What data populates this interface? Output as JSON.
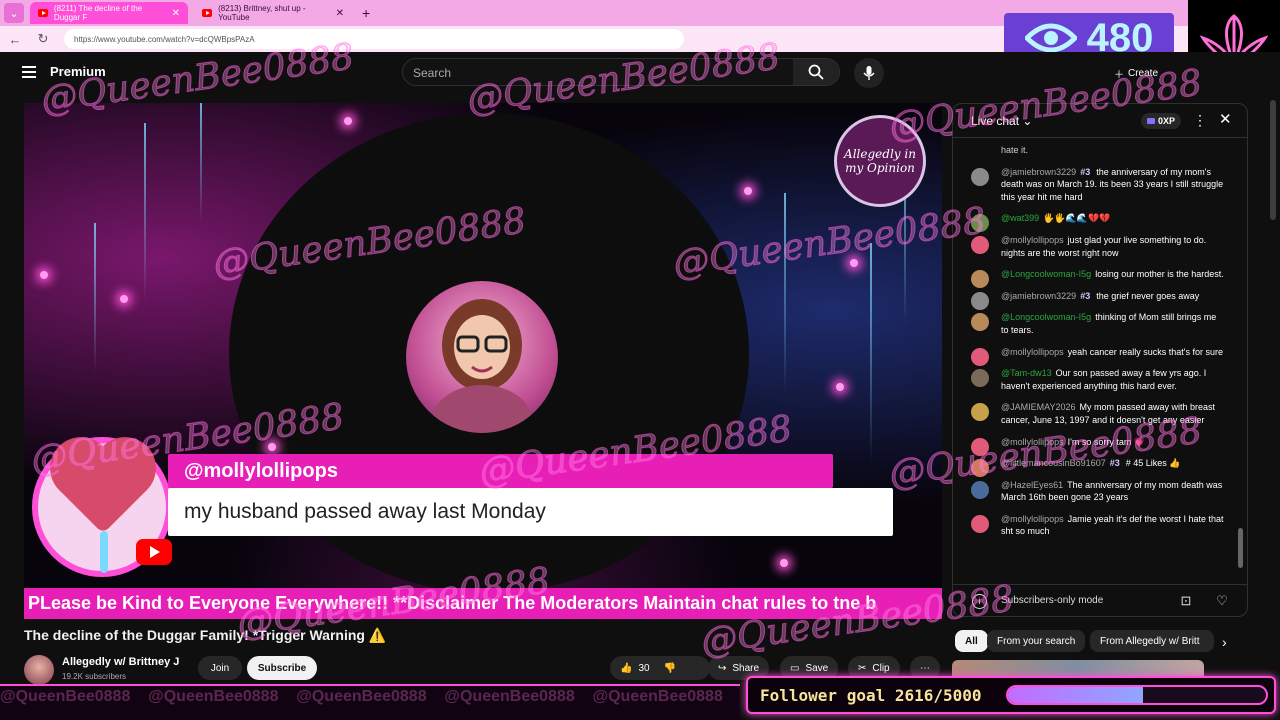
{
  "browser": {
    "tabs": [
      {
        "title": "(8211) The decline of the Duggar F",
        "active": true
      },
      {
        "title": "(8213) Brittney, shut up - YouTube",
        "active": false
      }
    ],
    "url": "https://www.youtube.com/watch?v=dcQWBpsPAzA"
  },
  "overlay": {
    "viewer_count": "480",
    "watermark": "@QueenBee0888",
    "follower_goal": {
      "label": "Follower goal 2616/5000",
      "current": 2616,
      "target": 5000,
      "fraction": 0.5232
    }
  },
  "header": {
    "logo_text": "Premium",
    "search_placeholder": "Search",
    "create_label": "Create"
  },
  "video": {
    "channel_badge": "Allegedly in my Opinion",
    "highlight_user": "@mollylollipops",
    "highlight_message": "my husband passed away last Monday",
    "ticker": "PLease be Kind to Everyone Everywhere!! **Disclaimer The Moderators Maintain chat rules to tne b",
    "title": "The decline of the Duggar Family! *Trigger Warning",
    "title_emoji": "⚠️"
  },
  "channel": {
    "name": "Allegedly w/ Brittney J",
    "subscribers": "19.2K subscribers",
    "join_label": "Join",
    "subscribe_label": "Subscribe"
  },
  "actions": {
    "likes": "30",
    "share_label": "Share",
    "save_label": "Save",
    "clip_label": "Clip"
  },
  "chat": {
    "title": "Live chat",
    "xp": "0XP",
    "top_fragment": "hate it.",
    "messages": [
      {
        "author": "@jamiebrown3229",
        "rank": "#3",
        "text": "the anniversary of my mom's death was on March 19. its been 33 years I still struggle this year hit me hard",
        "author_color": "gray",
        "avatar": "#8a8a8a"
      },
      {
        "author": "@wat399",
        "rank": "",
        "text": "🖐🖐🌊🌊💔💔",
        "author_color": "green",
        "avatar": "#6b8e4e"
      },
      {
        "author": "@mollylollipops",
        "rank": "",
        "text": "just glad your live something to do. nights are the worst right now",
        "author_color": "gray",
        "avatar": "#e05a7a"
      },
      {
        "author": "@Longcoolwoman-I5g",
        "rank": "",
        "text": "losing our mother is the hardest.",
        "author_color": "green",
        "avatar": "#b88a5a"
      },
      {
        "author": "@jamiebrown3229",
        "rank": "#3",
        "text": "the grief never goes away",
        "author_color": "gray",
        "avatar": "#8a8a8a"
      },
      {
        "author": "@Longcoolwoman-I5g",
        "rank": "",
        "text": "thinking of Mom still brings me to tears.",
        "author_color": "green",
        "avatar": "#b88a5a"
      },
      {
        "author": "@mollylollipops",
        "rank": "",
        "text": "yeah cancer really sucks that's for sure",
        "author_color": "gray",
        "avatar": "#e05a7a"
      },
      {
        "author": "@Tam-dw13",
        "rank": "",
        "text": "Our son passed away a few yrs ago. I haven't experienced anything this hard ever.",
        "author_color": "green",
        "avatar": "#7a6a5a"
      },
      {
        "author": "@JAMIEMAY2026",
        "rank": "",
        "text": "My mom passed away with breast cancer, June 13, 1997 and it doesn't get any easier",
        "author_color": "gray",
        "avatar": "#c9a04a"
      },
      {
        "author": "@mollylollipops",
        "rank": "",
        "text": "I'm so sorry tam 💗",
        "author_color": "gray",
        "avatar": "#e05a7a"
      },
      {
        "author": "@littlemancousinBo91607",
        "rank": "#3",
        "text": "# 45 Likes 👍",
        "author_color": "gray",
        "avatar": "#d07a5a"
      },
      {
        "author": "@HazelEyes61",
        "rank": "",
        "text": "The anniversary of my mom death was March 16th been gone 23 years",
        "author_color": "gray",
        "avatar": "#4a6a9a"
      },
      {
        "author": "@mollylollipops",
        "rank": "",
        "text": "Jamie yeah it's def the worst I hate that sht so much",
        "author_color": "gray",
        "avatar": "#e05a7a"
      }
    ],
    "footer_label": "Subscribers-only mode"
  },
  "chips": [
    "All",
    "From your search",
    "From Allegedly w/ Britt"
  ],
  "colors": {
    "accent": "#ff4fd8",
    "ticker": "#e81fb6",
    "viewer_box": "#6a3fd3"
  }
}
